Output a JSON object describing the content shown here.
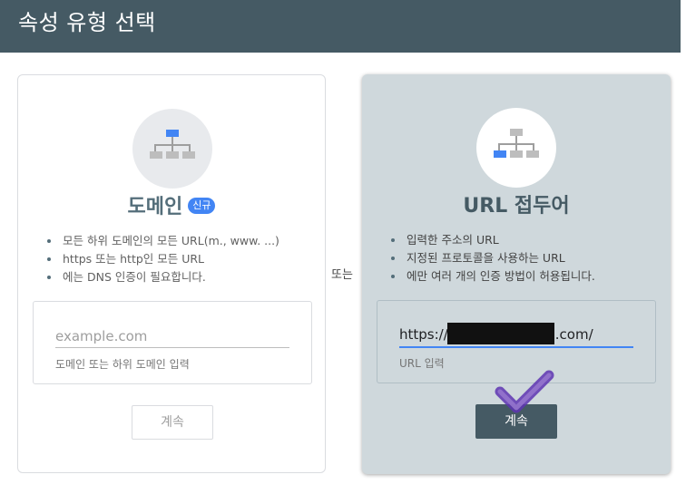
{
  "header": {
    "title": "속성 유형 선택"
  },
  "domain_card": {
    "title": "도메인",
    "badge": "신규",
    "bullets": [
      "모든 하위 도메인의 모든 URL(m., www. ...)",
      "https 또는 http인 모든 URL",
      "에는 DNS 인증이 필요합니다."
    ],
    "input": {
      "value": "",
      "placeholder": "example.com",
      "helper": "도메인 또는 하위 도메인 입력"
    },
    "button_label": "계속",
    "icon": "sitemap-icon"
  },
  "separator": {
    "label": "또는"
  },
  "url_prefix_card": {
    "title": "URL 접두어",
    "bullets": [
      "입력한 주소의 URL",
      "지정된 프로토콜을 사용하는 URL",
      "에만 여러 개의 인증 방법이 허용됩니다."
    ],
    "input": {
      "value_prefix": "https://",
      "value_suffix": ".com/",
      "helper": "URL 입력"
    },
    "button_label": "계속",
    "icon": "sitemap-icon"
  },
  "colors": {
    "header_bg": "#455a64",
    "accent_blue": "#4285f4",
    "selected_card_bg": "#cfd8dc",
    "primary_button_bg": "#455a64",
    "check_mark": "#7e57c2"
  }
}
